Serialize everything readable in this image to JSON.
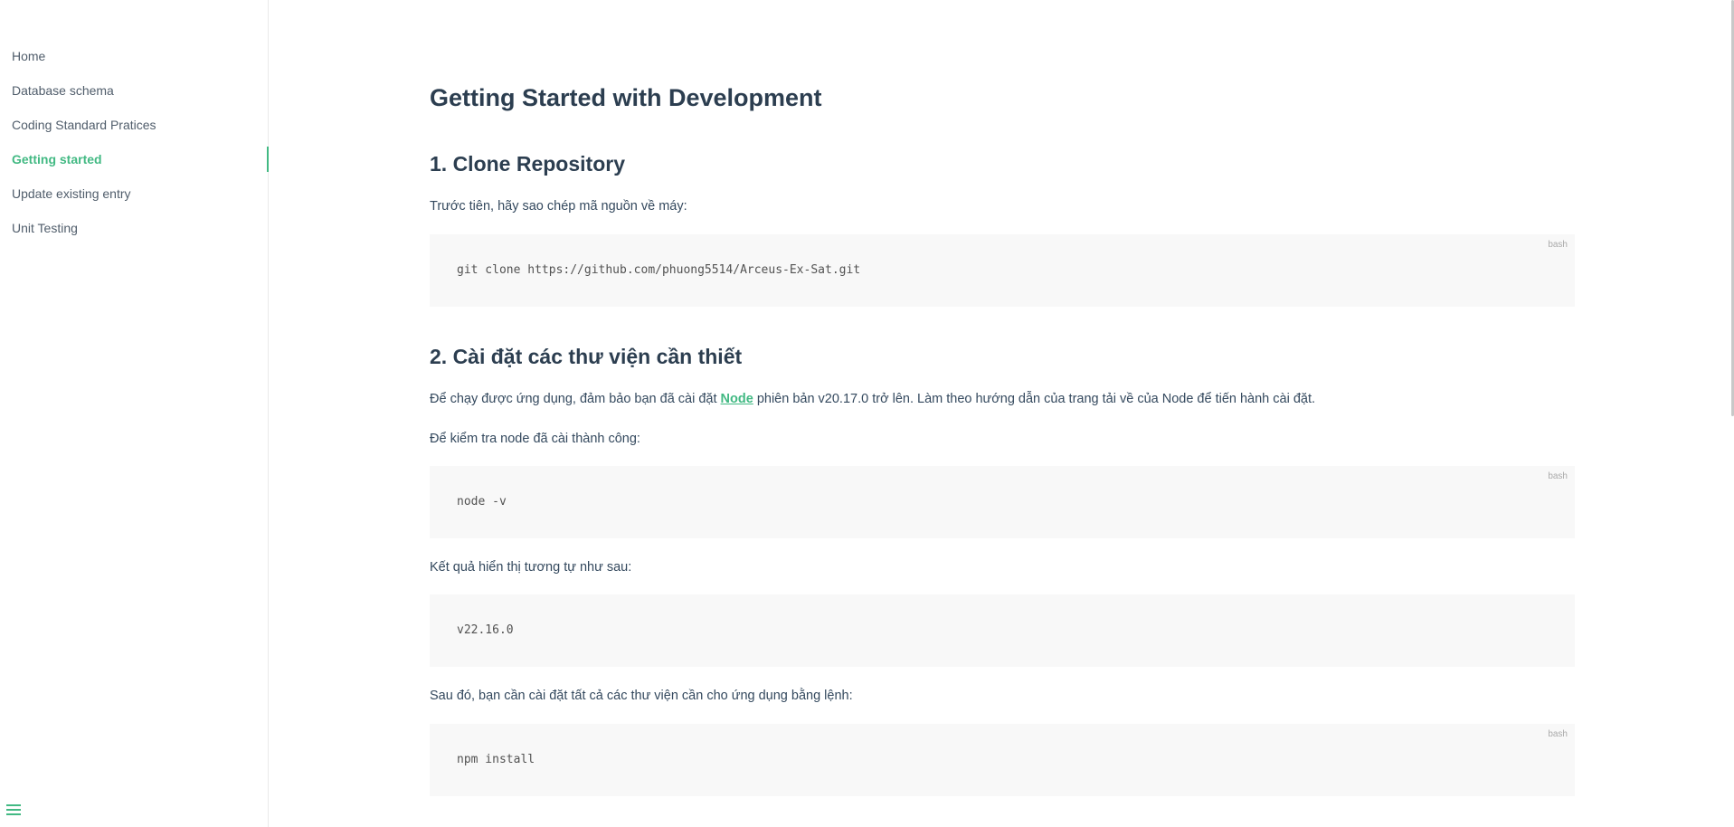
{
  "sidebar": {
    "items": [
      {
        "label": "Home"
      },
      {
        "label": "Database schema"
      },
      {
        "label": "Coding Standard Pratices"
      },
      {
        "label": "Getting started",
        "active": true
      },
      {
        "label": "Update existing entry"
      },
      {
        "label": "Unit Testing"
      }
    ],
    "toggle_icon": "hamburger-menu-icon"
  },
  "main": {
    "title": "Getting Started with Development",
    "section1": {
      "heading": "1. Clone Repository",
      "intro": "Trước tiên, hãy sao chép mã nguồn về máy:",
      "code": "git clone https://github.com/phuong5514/Arceus-Ex-Sat.git",
      "code_lang": "bash"
    },
    "section2": {
      "heading": "2. Cài đặt các thư viện cần thiết",
      "intro_before_link": "Để chạy được ứng dụng, đảm bảo bạn đã cài đặt ",
      "link_text": "Node",
      "intro_after_link": " phiên bản v20.17.0 trở lên. Làm theo hướng dẫn của trang tải về của Node để tiến hành cài đặt.",
      "check_text": "Để kiểm tra node đã cài thành công:",
      "check_code": "node -v",
      "check_code_lang": "bash",
      "result_text": "Kết quả hiển thị tương tự như sau:",
      "result_code": "v22.16.0",
      "install_text": "Sau đó, bạn cần cài đặt tất cả các thư viện cần cho ứng dụng bằng lệnh:",
      "install_code": "npm install",
      "install_code_lang": "bash"
    }
  },
  "colors": {
    "accent": "#42b983",
    "heading": "#2c3e50",
    "text": "#34495e",
    "code_bg": "#f8f8f8"
  }
}
